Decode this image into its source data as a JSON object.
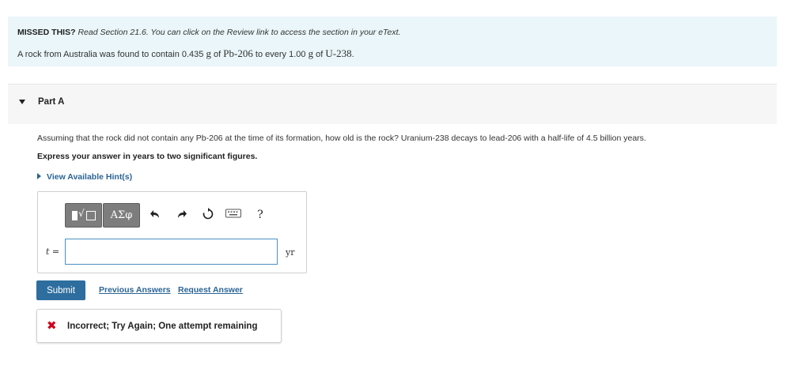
{
  "info": {
    "missed_label": "MISSED THIS?",
    "missed_text": "Read Section 21.6. You can click on the Review link to access the section in your eText.",
    "rock_pre": "A rock from Australia was found to contain 0.435",
    "unit_g1": "g",
    "of1": "of",
    "pb": "Pb-206",
    "to_every": "to every 1.00",
    "unit_g2": "g",
    "of2": "of",
    "u": "U-238",
    "period": "."
  },
  "part": {
    "label": "Part A"
  },
  "question": {
    "text": "Assuming that the rock did not contain any Pb-206 at the time of its formation, how old is the rock? Uranium-238 decays to lead-206 with a half-life of 4.5 billion years.",
    "express": "Express your answer in years to two significant figures.",
    "hint_label": "View Available Hint(s)"
  },
  "answer": {
    "variable": "t",
    "equals": "=",
    "value": "",
    "unit": "yr",
    "toolbar": {
      "greek_label": "ΑΣφ",
      "help_label": "?"
    }
  },
  "actions": {
    "submit": "Submit",
    "previous_answers": "Previous Answers",
    "request_answer": "Request Answer"
  },
  "feedback": {
    "text": "Incorrect; Try Again; One attempt remaining"
  },
  "colors": {
    "info_bg": "#eaf6f9",
    "accent": "#2e6e9e",
    "link": "#2a6496",
    "error": "#d0021b"
  }
}
